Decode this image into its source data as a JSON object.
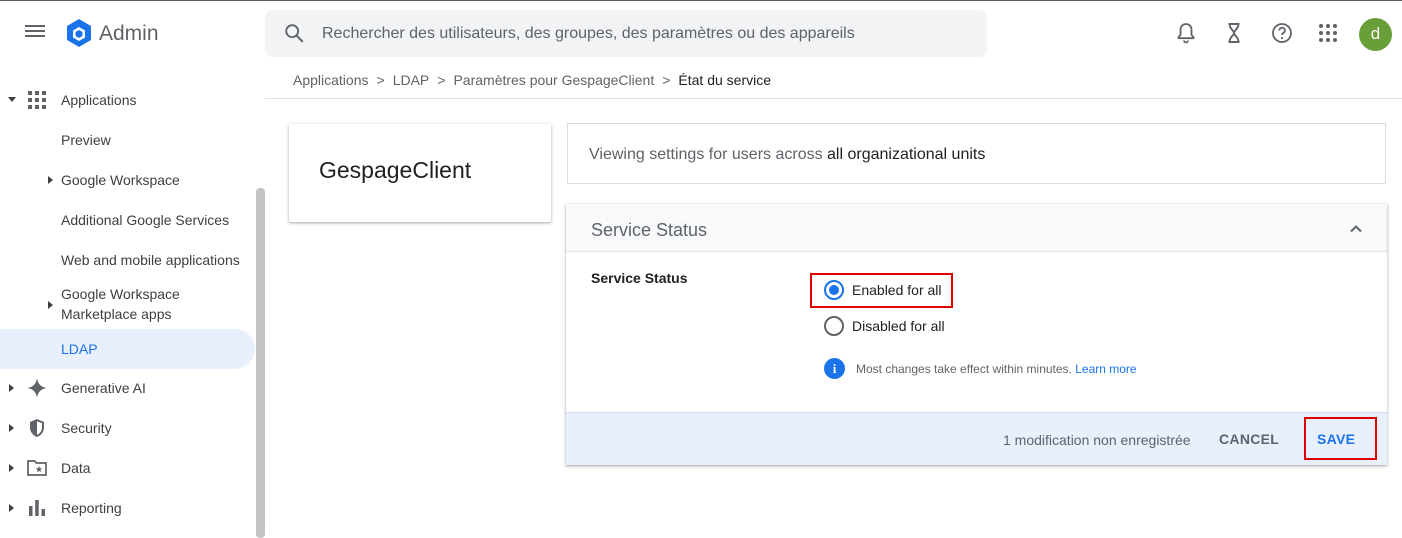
{
  "header": {
    "app_title": "Admin",
    "search_placeholder": "Rechercher des utilisateurs, des groupes, des paramètres ou des appareils",
    "avatar_letter": "d",
    "avatar_color": "#689f38"
  },
  "breadcrumb": {
    "items": [
      "Applications",
      "LDAP",
      "Paramètres pour GespageClient",
      "État du service"
    ],
    "separator": ">"
  },
  "sidebar": {
    "items": [
      {
        "label": "Applications",
        "icon": "apps-grid-icon",
        "arrow": "down"
      },
      {
        "label": "Preview"
      },
      {
        "label": "Google Workspace",
        "arrow": "right"
      },
      {
        "label": "Additional Google Services"
      },
      {
        "label": "Web and mobile applications"
      },
      {
        "label_line1": "Google Workspace",
        "label_line2": "Marketplace apps",
        "arrow": "right"
      },
      {
        "label": "LDAP",
        "active": true
      },
      {
        "label": "Generative AI",
        "icon": "sparkle-icon",
        "arrow": "right"
      },
      {
        "label": "Security",
        "icon": "shield-icon",
        "arrow": "right"
      },
      {
        "label": "Data",
        "icon": "folder-star-icon",
        "arrow": "right"
      },
      {
        "label": "Reporting",
        "icon": "bar-chart-icon",
        "arrow": "right"
      }
    ]
  },
  "app_card": {
    "title": "GespageClient"
  },
  "org_card": {
    "prefix": "Viewing settings for users across ",
    "scope": "all organizational units"
  },
  "service_status": {
    "header": "Service Status",
    "row_label": "Service Status",
    "options": [
      {
        "label": "Enabled for all",
        "checked": true
      },
      {
        "label": "Disabled for all",
        "checked": false
      }
    ],
    "info_text": "Most changes take effect within minutes. ",
    "learn_more": "Learn more",
    "unsaved": "1 modification non enregistrée",
    "cancel": "CANCEL",
    "save": "SAVE"
  },
  "colors": {
    "accent": "#1a73e8",
    "highlight": "#e00000",
    "active_bg": "#e8f0fe"
  }
}
